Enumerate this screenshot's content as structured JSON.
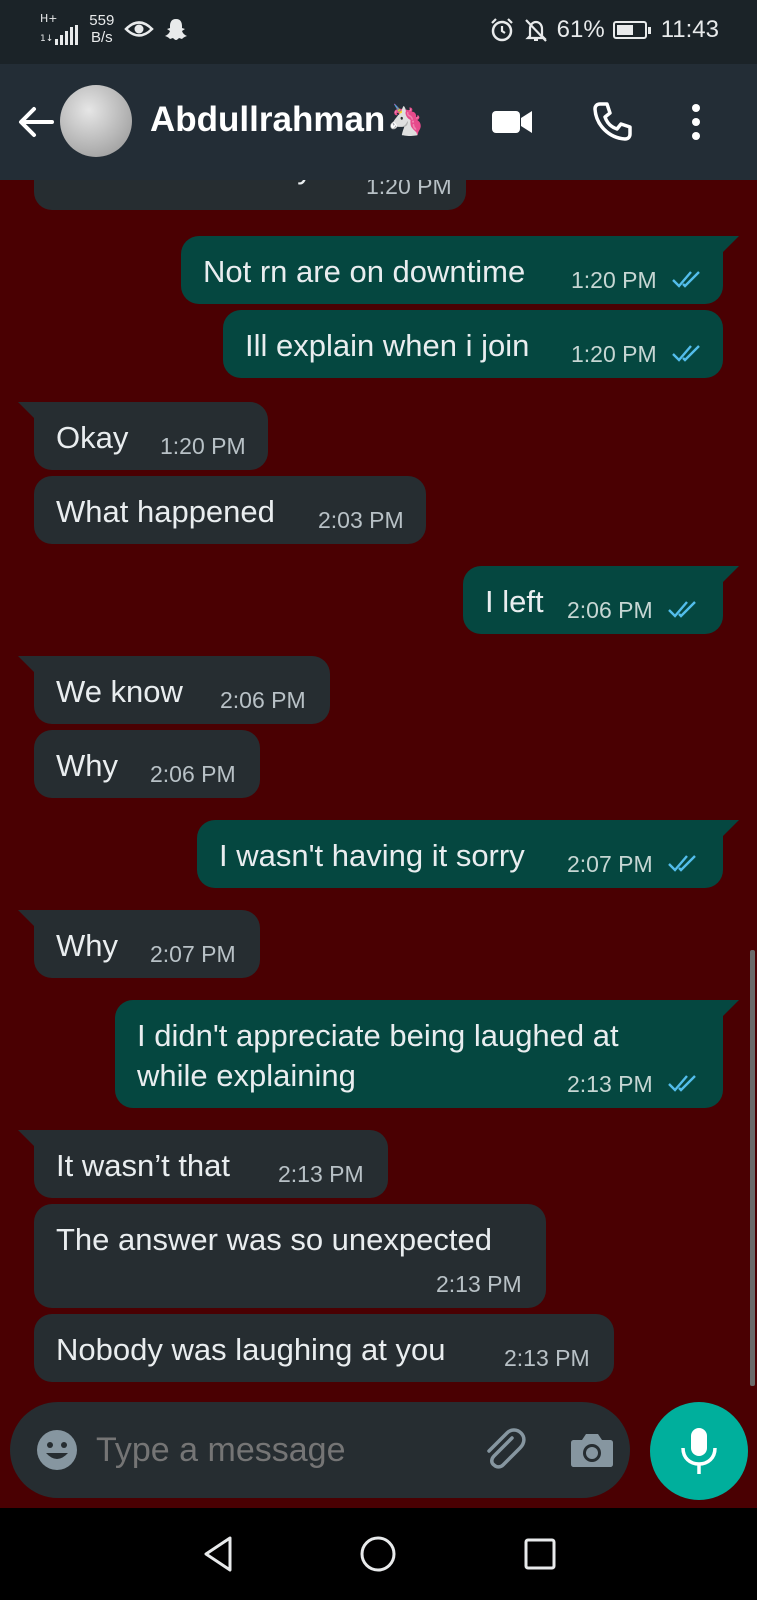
{
  "status_bar": {
    "network": "H+",
    "signal_sub": "1↓",
    "speed_value": "559",
    "speed_unit": "B/s",
    "battery_percent": "61%",
    "battery_level": 0.61,
    "time": "11:43"
  },
  "header": {
    "contact_name": "Abdullrahman",
    "contact_emoji": "🦄"
  },
  "messages": [
    {
      "dir": "in",
      "text": "What is technically",
      "time": "1:20 PM"
    },
    {
      "dir": "out",
      "text": "Not rn are on downtime",
      "time": "1:20 PM"
    },
    {
      "dir": "out",
      "text": "Ill explain when i join",
      "time": "1:20 PM"
    },
    {
      "dir": "in",
      "text": "Okay",
      "time": "1:20 PM"
    },
    {
      "dir": "in",
      "text": "What happened",
      "time": "2:03 PM"
    },
    {
      "dir": "out",
      "text": "I left",
      "time": "2:06 PM"
    },
    {
      "dir": "in",
      "text": "We know",
      "time": "2:06 PM"
    },
    {
      "dir": "in",
      "text": "Why",
      "time": "2:06 PM"
    },
    {
      "dir": "out",
      "text": "I wasn't having it sorry",
      "time": "2:07 PM"
    },
    {
      "dir": "in",
      "text": "Why",
      "time": "2:07 PM"
    },
    {
      "dir": "out",
      "text": "I didn't appreciate being laughed at",
      "text2": "while explaining",
      "time": "2:13 PM"
    },
    {
      "dir": "in",
      "text": "It wasn’t that",
      "time": "2:13 PM"
    },
    {
      "dir": "in",
      "text": "The answer was so unexpected",
      "time": "2:13 PM"
    },
    {
      "dir": "in",
      "text": "Nobody was laughing at you",
      "time": "2:13 PM"
    }
  ],
  "composer": {
    "placeholder": "Type a message"
  },
  "icons": {
    "back": "arrow-left-icon",
    "video": "video-call-icon",
    "call": "phone-icon",
    "menu": "more-vert-icon",
    "emoji": "emoji-icon",
    "attach": "paperclip-icon",
    "camera": "camera-icon",
    "mic": "microphone-icon",
    "read": "double-check-icon"
  },
  "colors": {
    "chat_background": "#4a0002",
    "incoming_bubble": "#262d31",
    "outgoing_bubble": "#054740",
    "read_ticks": "#53bdeb",
    "mic_button": "#00af9c"
  }
}
